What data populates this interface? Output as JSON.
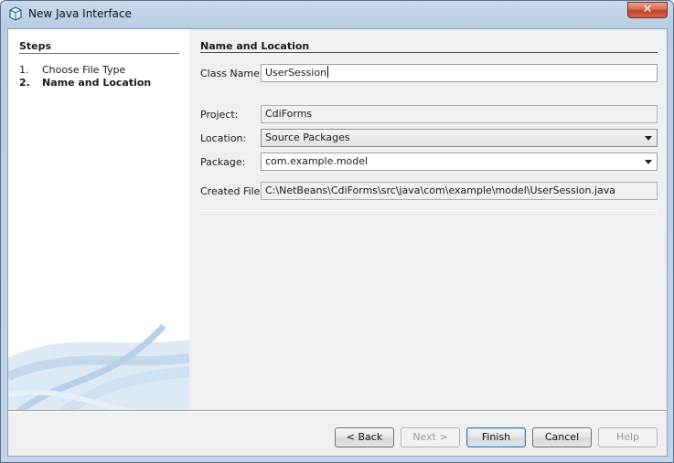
{
  "window": {
    "title": "New Java Interface"
  },
  "steps": {
    "heading": "Steps",
    "items": [
      {
        "num": "1.",
        "label": "Choose File Type",
        "current": false
      },
      {
        "num": "2.",
        "label": "Name and Location",
        "current": true
      }
    ]
  },
  "main": {
    "heading": "Name and Location",
    "class_name_label": "Class Name:",
    "class_name_value": "UserSession",
    "project_label": "Project:",
    "project_value": "CdiForms",
    "location_label": "Location:",
    "location_value": "Source Packages",
    "package_label": "Package:",
    "package_value": "com.example.model",
    "created_file_label": "Created File:",
    "created_file_value": "C:\\NetBeans\\CdiForms\\src\\java\\com\\example\\model\\UserSession.java"
  },
  "buttons": {
    "back": "< Back",
    "next": "Next >",
    "finish": "Finish",
    "cancel": "Cancel",
    "help": "Help"
  },
  "icons": {
    "window_icon": "netbeans-cube-icon",
    "close": "close-icon",
    "dropdown": "chevron-down-icon"
  },
  "colors": {
    "accent": "#3c7fb1",
    "close_button": "#c2432a",
    "title_bar": "#b8cde4"
  }
}
